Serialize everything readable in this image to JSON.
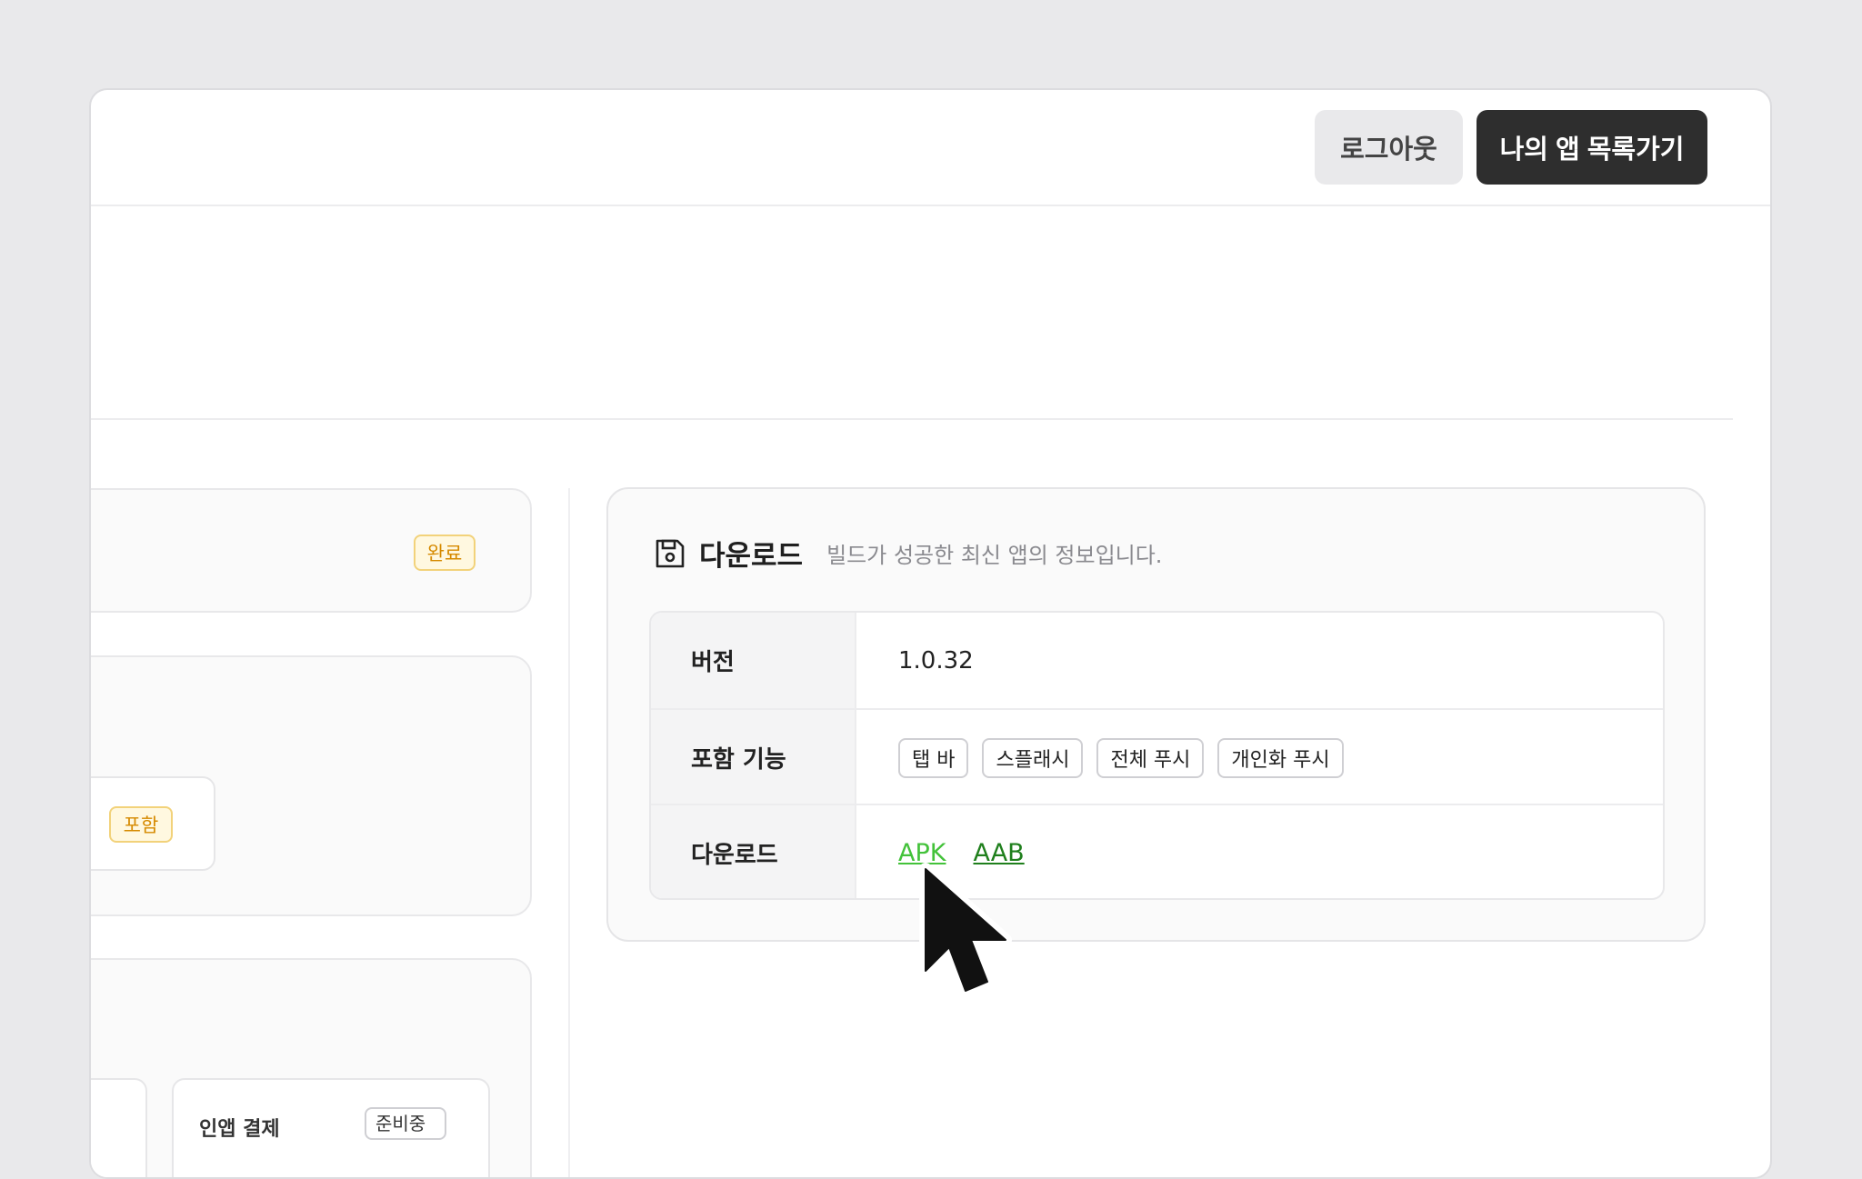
{
  "topbar": {
    "logout_label": "로그아웃",
    "my_apps_label": "나의 앱 목록가기"
  },
  "left_panel": {
    "status_badge": "완료",
    "feature_badge": "포함"
  },
  "download_card": {
    "title": "다운로드",
    "description": "빌드가 성공한 최신 앱의 정보입니다.",
    "rows": {
      "version": {
        "label": "버전",
        "value": "1.0.32"
      },
      "features": {
        "label": "포함 기능",
        "tags": [
          "탭 바",
          "스플래시",
          "전체 푸시",
          "개인화 푸시"
        ]
      },
      "downloads": {
        "label": "다운로드",
        "links": [
          "APK",
          "AAB"
        ]
      }
    }
  },
  "colors": {
    "primary_dark": "#2e2e2e",
    "badge_amber": "#d68a00",
    "link_apk": "#43c23a",
    "link_aab": "#1f7f1c"
  },
  "icons": {
    "download_section": "floppy-disk-icon",
    "pointer": "mouse-cursor-icon"
  }
}
